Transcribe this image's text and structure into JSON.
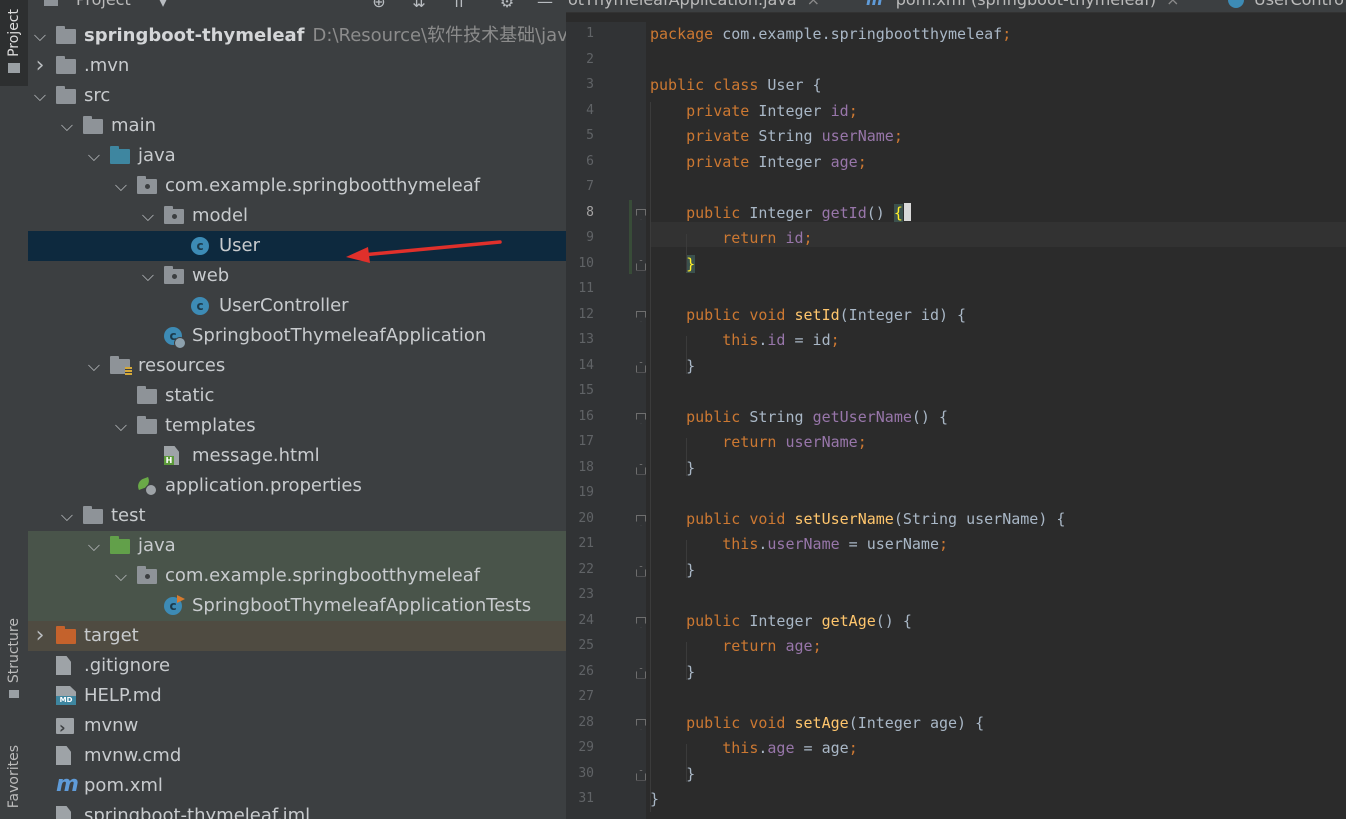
{
  "sidebar_tabs": {
    "project": "Project",
    "structure": "Structure",
    "favorites": "Favorites"
  },
  "panel": {
    "title": "Project",
    "header_icons": [
      "target-icon",
      "collapse-all-icon",
      "expand-all-icon",
      "gear-icon",
      "hide-icon"
    ]
  },
  "tree": [
    {
      "label": "springboot-thymeleaf",
      "path": "D:\\Resource\\软件技术基础\\java-learn",
      "icon": "module-folder-icon",
      "arrow": "down",
      "depth": 0,
      "bold": true
    },
    {
      "label": ".mvn",
      "icon": "folder-icon",
      "arrow": "right",
      "depth": 0
    },
    {
      "label": "src",
      "icon": "folder-icon",
      "arrow": "down",
      "depth": 0
    },
    {
      "label": "main",
      "icon": "folder-icon",
      "arrow": "down",
      "depth": 1
    },
    {
      "label": "java",
      "icon": "source-folder-icon",
      "arrow": "down",
      "depth": 2
    },
    {
      "label": "com.example.springbootthymeleaf",
      "icon": "package-icon",
      "arrow": "down",
      "depth": 3
    },
    {
      "label": "model",
      "icon": "package-icon",
      "arrow": "down",
      "depth": 4
    },
    {
      "label": "User",
      "icon": "class-icon",
      "arrow": "none",
      "depth": 5,
      "selected": true
    },
    {
      "label": "web",
      "icon": "package-icon",
      "arrow": "down",
      "depth": 4
    },
    {
      "label": "UserController",
      "icon": "class-icon",
      "arrow": "none",
      "depth": 5
    },
    {
      "label": "SpringbootThymeleafApplication",
      "icon": "spring-boot-class-icon",
      "arrow": "none",
      "depth": 4
    },
    {
      "label": "resources",
      "icon": "resources-folder-icon",
      "arrow": "down",
      "depth": 2
    },
    {
      "label": "static",
      "icon": "folder-icon",
      "arrow": "none",
      "depth": 3
    },
    {
      "label": "templates",
      "icon": "folder-icon",
      "arrow": "down",
      "depth": 3
    },
    {
      "label": "message.html",
      "icon": "html-file-icon",
      "arrow": "none",
      "depth": 4
    },
    {
      "label": "application.properties",
      "icon": "properties-file-icon",
      "arrow": "none",
      "depth": 3
    },
    {
      "label": "test",
      "icon": "folder-icon",
      "arrow": "down",
      "depth": 1
    },
    {
      "label": "java",
      "icon": "test-source-folder-icon",
      "arrow": "down",
      "depth": 2,
      "test": true
    },
    {
      "label": "com.example.springbootthymeleaf",
      "icon": "package-icon",
      "arrow": "down",
      "depth": 3,
      "test": true
    },
    {
      "label": "SpringbootThymeleafApplicationTests",
      "icon": "test-class-icon",
      "arrow": "none",
      "depth": 4,
      "test": true
    },
    {
      "label": "target",
      "icon": "excluded-folder-icon",
      "arrow": "right",
      "depth": 0,
      "excluded": true
    },
    {
      "label": ".gitignore",
      "icon": "ignore-file-icon",
      "arrow": "none",
      "depth": 0
    },
    {
      "label": "HELP.md",
      "icon": "markdown-file-icon",
      "arrow": "none",
      "depth": 0
    },
    {
      "label": "mvnw",
      "icon": "shell-script-icon",
      "arrow": "none",
      "depth": 0
    },
    {
      "label": "mvnw.cmd",
      "icon": "cmd-file-icon",
      "arrow": "none",
      "depth": 0
    },
    {
      "label": "pom.xml",
      "icon": "maven-icon",
      "arrow": "none",
      "depth": 0
    },
    {
      "label": "springboot-thymeleaf.iml",
      "icon": "iml-file-icon",
      "arrow": "none",
      "depth": 0
    }
  ],
  "editor_tabs": [
    {
      "label": "otThymeleafApplication.java",
      "icon": "none",
      "close": "×"
    },
    {
      "label": "pom.xml (springboot-thymeleaf)",
      "icon": "maven-icon",
      "close": "×"
    },
    {
      "label": "UserContro",
      "icon": "class-icon",
      "close": ""
    }
  ],
  "code": {
    "current_line": 8,
    "lines": [
      [
        [
          "kw",
          "package "
        ],
        [
          "t",
          "com.example.springbootthymeleaf"
        ],
        [
          "kw",
          ";"
        ]
      ],
      [],
      [
        [
          "kw",
          "public class "
        ],
        [
          "t",
          "User {"
        ]
      ],
      [
        [
          "t",
          "    "
        ],
        [
          "kw",
          "private "
        ],
        [
          "t",
          "Integer "
        ],
        [
          "fld",
          "id"
        ],
        [
          "kw",
          ";"
        ]
      ],
      [
        [
          "t",
          "    "
        ],
        [
          "kw",
          "private "
        ],
        [
          "t",
          "String "
        ],
        [
          "fld",
          "userName"
        ],
        [
          "kw",
          ";"
        ]
      ],
      [
        [
          "t",
          "    "
        ],
        [
          "kw",
          "private "
        ],
        [
          "t",
          "Integer "
        ],
        [
          "fld",
          "age"
        ],
        [
          "kw",
          ";"
        ]
      ],
      [],
      [
        [
          "t",
          "    "
        ],
        [
          "kw",
          "public "
        ],
        [
          "t",
          "Integer "
        ],
        [
          "mth2",
          "getId"
        ],
        [
          "t",
          "() "
        ],
        [
          "brace",
          "{"
        ],
        [
          "caret",
          ""
        ]
      ],
      [
        [
          "t",
          "        "
        ],
        [
          "kw",
          "return "
        ],
        [
          "fld",
          "id"
        ],
        [
          "kw",
          ";"
        ]
      ],
      [
        [
          "t",
          "    "
        ],
        [
          "brace",
          "}"
        ]
      ],
      [],
      [
        [
          "t",
          "    "
        ],
        [
          "kw",
          "public void "
        ],
        [
          "mth",
          "setId"
        ],
        [
          "t",
          "(Integer id) {"
        ]
      ],
      [
        [
          "t",
          "        "
        ],
        [
          "kw",
          "this"
        ],
        [
          "t",
          "."
        ],
        [
          "fld",
          "id"
        ],
        [
          "t",
          " = id"
        ],
        [
          "kw",
          ";"
        ]
      ],
      [
        [
          "t",
          "    }"
        ]
      ],
      [],
      [
        [
          "t",
          "    "
        ],
        [
          "kw",
          "public "
        ],
        [
          "t",
          "String "
        ],
        [
          "mth2",
          "getUserName"
        ],
        [
          "t",
          "() {"
        ]
      ],
      [
        [
          "t",
          "        "
        ],
        [
          "kw",
          "return "
        ],
        [
          "fld",
          "userName"
        ],
        [
          "kw",
          ";"
        ]
      ],
      [
        [
          "t",
          "    }"
        ]
      ],
      [],
      [
        [
          "t",
          "    "
        ],
        [
          "kw",
          "public void "
        ],
        [
          "mth",
          "setUserName"
        ],
        [
          "t",
          "(String userName) {"
        ]
      ],
      [
        [
          "t",
          "        "
        ],
        [
          "kw",
          "this"
        ],
        [
          "t",
          "."
        ],
        [
          "fld",
          "userName"
        ],
        [
          "t",
          " = userName"
        ],
        [
          "kw",
          ";"
        ]
      ],
      [
        [
          "t",
          "    }"
        ]
      ],
      [],
      [
        [
          "t",
          "    "
        ],
        [
          "kw",
          "public "
        ],
        [
          "t",
          "Integer "
        ],
        [
          "mth",
          "getAge"
        ],
        [
          "t",
          "() {"
        ]
      ],
      [
        [
          "t",
          "        "
        ],
        [
          "kw",
          "return "
        ],
        [
          "fld",
          "age"
        ],
        [
          "kw",
          ";"
        ]
      ],
      [
        [
          "t",
          "    }"
        ]
      ],
      [],
      [
        [
          "t",
          "    "
        ],
        [
          "kw",
          "public void "
        ],
        [
          "mth",
          "setAge"
        ],
        [
          "t",
          "(Integer age) {"
        ]
      ],
      [
        [
          "t",
          "        "
        ],
        [
          "kw",
          "this"
        ],
        [
          "t",
          "."
        ],
        [
          "fld",
          "age"
        ],
        [
          "t",
          " = age"
        ],
        [
          "kw",
          ";"
        ]
      ],
      [
        [
          "t",
          "    }"
        ]
      ],
      [
        [
          "t",
          "}"
        ]
      ]
    ]
  },
  "annotation": {
    "type": "red-arrow",
    "points_to": "User",
    "color": "#e0302b"
  },
  "colors": {
    "panel_bg": "#3c3f41",
    "editor_bg": "#2b2b2b",
    "selection": "#0d293e",
    "keyword": "#cc7832",
    "field": "#9876aa",
    "method": "#ffc66d",
    "test_row": "#49544a",
    "excluded_row": "#4f4b41"
  }
}
